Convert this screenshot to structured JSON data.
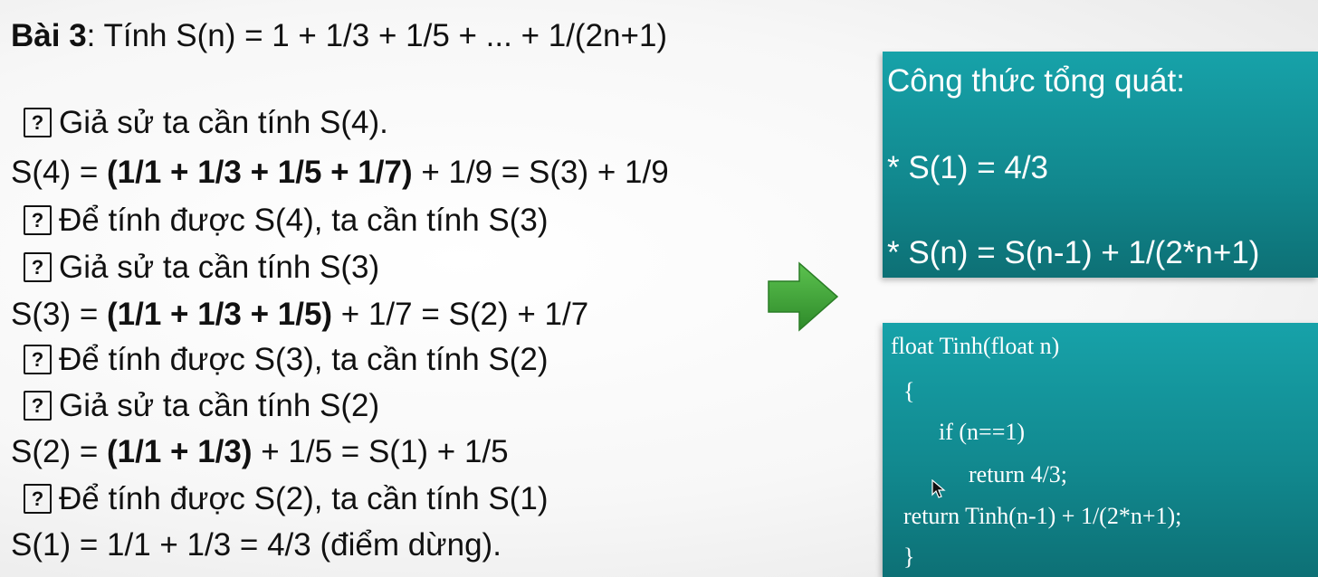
{
  "title": {
    "label": "Bài 3",
    "rest": ": Tính S(n) = 1 + 1/3 + 1/5 + ... + 1/(2n+1)"
  },
  "q_icon": "?",
  "lines": {
    "l1": "Giả sử ta cần tính S(4).",
    "l2a": "S(4) = ",
    "l2b": "(1/1 + 1/3 + 1/5  + 1/7)",
    "l2c": " + 1/9 = S(3) + 1/9",
    "l3": "Để tính được S(4), ta cần tính S(3)",
    "l4": "Giả sử ta cần tính S(3)",
    "l5a": "S(3) = ",
    "l5b": "(1/1 + 1/3 + 1/5)",
    "l5c": "  + 1/7 = S(2) + 1/7",
    "l6": "Để tính được S(3), ta cần tính S(2)",
    "l7": "Giả sử ta cần tính S(2)",
    "l8a": "S(2) = ",
    "l8b": "(1/1 + 1/3)",
    "l8c": " + 1/5 = S(1) + 1/5",
    "l9": "Để tính được S(2), ta cần tính S(1)",
    "l10": "S(1) = 1/1 + 1/3 = 4/3 (điểm dừng)."
  },
  "formula_panel": {
    "heading": "Công thức tổng quát:",
    "base": "* S(1) = 4/3",
    "recursive": "* S(n) = S(n-1) + 1/(2*n+1)"
  },
  "code_panel": {
    "lines": [
      "float Tinh(float n)",
      "{",
      "if (n==1)",
      "return 4/3;",
      "return Tinh(n-1) + 1/(2*n+1);",
      "}"
    ]
  },
  "colors": {
    "panel_teal": "#17a2a9",
    "arrow_green": "#3aa033",
    "text": "#111111"
  },
  "icons": [
    "question-box-icon",
    "right-arrow-icon",
    "mouse-cursor-icon"
  ]
}
